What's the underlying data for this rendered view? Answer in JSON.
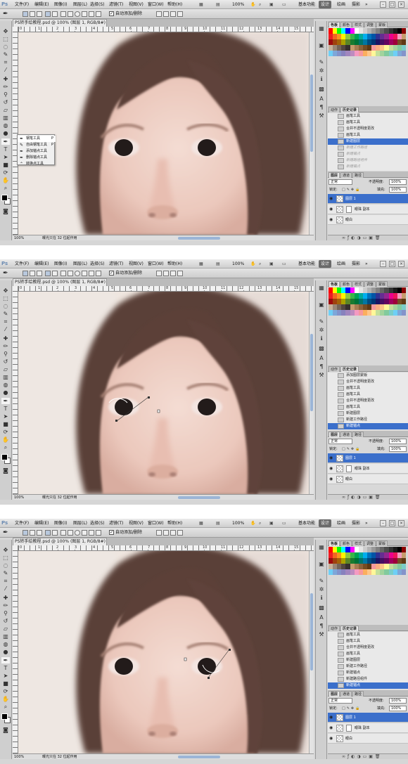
{
  "app": {
    "logo": "Ps"
  },
  "menu": [
    "文件(F)",
    "编辑(E)",
    "图像(I)",
    "图层(L)",
    "选择(S)",
    "滤镜(T)",
    "视图(V)",
    "窗口(W)",
    "帮助(H)"
  ],
  "zoom_readout": "100%",
  "workspaces": [
    "基本功能",
    "设计",
    "绘画",
    "摄影"
  ],
  "options_bar": {
    "auto_add_delete_label": "自动添加/删除"
  },
  "document": {
    "tab_title": "PS转手绘教程.psd @ 100% (图层 1, RGB/8#) *",
    "ruler_ticks": [
      "0",
      "1",
      "2",
      "3",
      "4",
      "5",
      "6",
      "7",
      "8",
      "9",
      "10",
      "11",
      "12",
      "13",
      "14",
      "15"
    ],
    "status_zoom": "100%",
    "status_info": "曝光只在 32 位起作用"
  },
  "panels": {
    "swatch_tabs": [
      "色板",
      "颜色",
      "样式",
      "调整",
      "蒙版"
    ],
    "history_tabs": [
      "动作",
      "历史记录"
    ],
    "layer_tabs": [
      "图层",
      "通道",
      "路径"
    ],
    "blend_mode": "正常",
    "opacity_label": "不透明度:",
    "opacity_value": "100%",
    "lock_label": "锁定:",
    "fill_label": "填充:",
    "fill_value": "100%",
    "layers": [
      "图层 1",
      "眼珠 副本",
      "眼白"
    ]
  },
  "tool_flyout": {
    "items": [
      {
        "label": "钢笔工具",
        "key": "P"
      },
      {
        "label": "自由钢笔工具",
        "key": "P"
      },
      {
        "label": "添加锚点工具",
        "key": ""
      },
      {
        "label": "删除锚点工具",
        "key": ""
      },
      {
        "label": "转换点工具",
        "key": ""
      }
    ]
  },
  "screens": [
    {
      "history": [
        {
          "label": "画笔工具",
          "state": "normal"
        },
        {
          "label": "画笔工具",
          "state": "normal"
        },
        {
          "label": "合并不透明度更改",
          "state": "normal"
        },
        {
          "label": "画笔工具",
          "state": "normal"
        },
        {
          "label": "新建图层",
          "state": "selected"
        },
        {
          "label": "新建工作路径",
          "state": "dim"
        },
        {
          "label": "新建锚点",
          "state": "dim"
        },
        {
          "label": "新建路径组件",
          "state": "dim"
        },
        {
          "label": "新建锚点",
          "state": "dim"
        }
      ]
    },
    {
      "history": [
        {
          "label": "添加图层蒙版",
          "state": "normal"
        },
        {
          "label": "合并不透明度更改",
          "state": "normal"
        },
        {
          "label": "画笔工具",
          "state": "normal"
        },
        {
          "label": "画笔工具",
          "state": "normal"
        },
        {
          "label": "合并不透明度更改",
          "state": "normal"
        },
        {
          "label": "画笔工具",
          "state": "normal"
        },
        {
          "label": "新建图层",
          "state": "normal"
        },
        {
          "label": "新建工作路径",
          "state": "normal"
        },
        {
          "label": "新建锚点",
          "state": "selected"
        }
      ]
    },
    {
      "history": [
        {
          "label": "画笔工具",
          "state": "normal"
        },
        {
          "label": "画笔工具",
          "state": "normal"
        },
        {
          "label": "合并不透明度更改",
          "state": "normal"
        },
        {
          "label": "画笔工具",
          "state": "normal"
        },
        {
          "label": "新建图层",
          "state": "normal"
        },
        {
          "label": "新建工作路径",
          "state": "normal"
        },
        {
          "label": "新建锚点",
          "state": "normal"
        },
        {
          "label": "新建路径组件",
          "state": "normal"
        },
        {
          "label": "新建锚点",
          "state": "selected"
        }
      ]
    }
  ],
  "colors": {
    "accent": "#3b6fcb",
    "chrome": "#d6d6d6"
  }
}
